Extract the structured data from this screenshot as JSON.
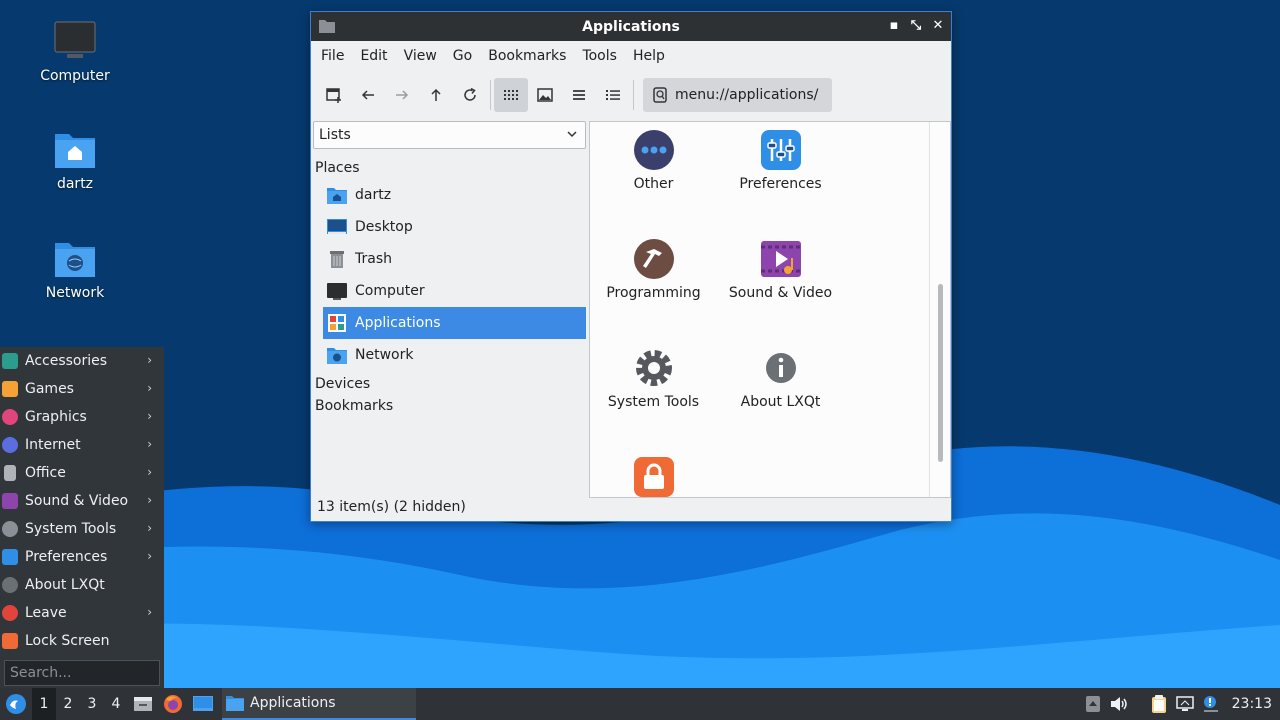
{
  "desktop": {
    "icons": [
      {
        "label": "Computer",
        "icon": "computer-icon"
      },
      {
        "label": "dartz",
        "icon": "home-folder-icon"
      },
      {
        "label": "Network",
        "icon": "network-folder-icon"
      }
    ]
  },
  "window": {
    "title": "Applications",
    "controls": {
      "minimize": "▪",
      "restore": "⤡",
      "close": "✕"
    },
    "menubar": [
      "File",
      "Edit",
      "View",
      "Go",
      "Bookmarks",
      "Tools",
      "Help"
    ],
    "toolbar": {
      "buttons": [
        "new-tab-icon",
        "back-icon",
        "forward-icon",
        "up-icon",
        "reload-icon",
        "icon-view-icon",
        "thumbnail-view-icon",
        "compact-view-icon",
        "detailed-list-icon"
      ],
      "path": "menu://applications/"
    },
    "sidepanel": {
      "select_value": "Lists",
      "places_heading": "Places",
      "places": [
        {
          "label": "dartz",
          "icon": "home-folder-icon"
        },
        {
          "label": "Desktop",
          "icon": "desktop-icon"
        },
        {
          "label": "Trash",
          "icon": "trash-icon"
        },
        {
          "label": "Computer",
          "icon": "computer-icon"
        },
        {
          "label": "Applications",
          "icon": "applications-icon",
          "selected": true
        },
        {
          "label": "Network",
          "icon": "network-folder-icon"
        }
      ],
      "devices_heading": "Devices",
      "bookmarks_heading": "Bookmarks"
    },
    "apps": [
      {
        "label": "Other",
        "icon": "other-icon"
      },
      {
        "label": "Preferences",
        "icon": "preferences-icon"
      },
      {
        "label": "Programming",
        "icon": "programming-icon"
      },
      {
        "label": "Sound & Video",
        "icon": "sound-video-icon"
      },
      {
        "label": "System Tools",
        "icon": "system-tools-icon"
      },
      {
        "label": "About LXQt",
        "icon": "about-icon"
      },
      {
        "label": "",
        "icon": "lock-icon"
      }
    ],
    "status": "13 item(s) (2 hidden)"
  },
  "start_menu": {
    "items": [
      {
        "label": "Accessories",
        "submenu": true,
        "color": "#2a9d8f"
      },
      {
        "label": "Games",
        "submenu": true,
        "color": "#f4a236"
      },
      {
        "label": "Graphics",
        "submenu": true,
        "color": "#e0457b"
      },
      {
        "label": "Internet",
        "submenu": true,
        "color": "#5b6ee1"
      },
      {
        "label": "Office",
        "submenu": true,
        "color": "#b0b4b8"
      },
      {
        "label": "Sound & Video",
        "submenu": true,
        "color": "#8e44ad"
      },
      {
        "label": "System Tools",
        "submenu": true,
        "color": "#8b9096"
      },
      {
        "label": "Preferences",
        "submenu": true,
        "color": "#2f8fe6"
      },
      {
        "label": "About LXQt",
        "submenu": false,
        "color": "#6b7075"
      },
      {
        "label": "Leave",
        "submenu": true,
        "color": "#e0443a"
      },
      {
        "label": "Lock Screen",
        "submenu": false,
        "color": "#f06a35"
      }
    ],
    "search_placeholder": "Search..."
  },
  "taskbar": {
    "desktops": [
      "1",
      "2",
      "3",
      "4"
    ],
    "active_desktop": "1",
    "task_label": "Applications",
    "clock": "23:13"
  },
  "colors": {
    "accent": "#3d8ae5",
    "panel": "#2f3337",
    "window_bg": "#eff0f1"
  }
}
